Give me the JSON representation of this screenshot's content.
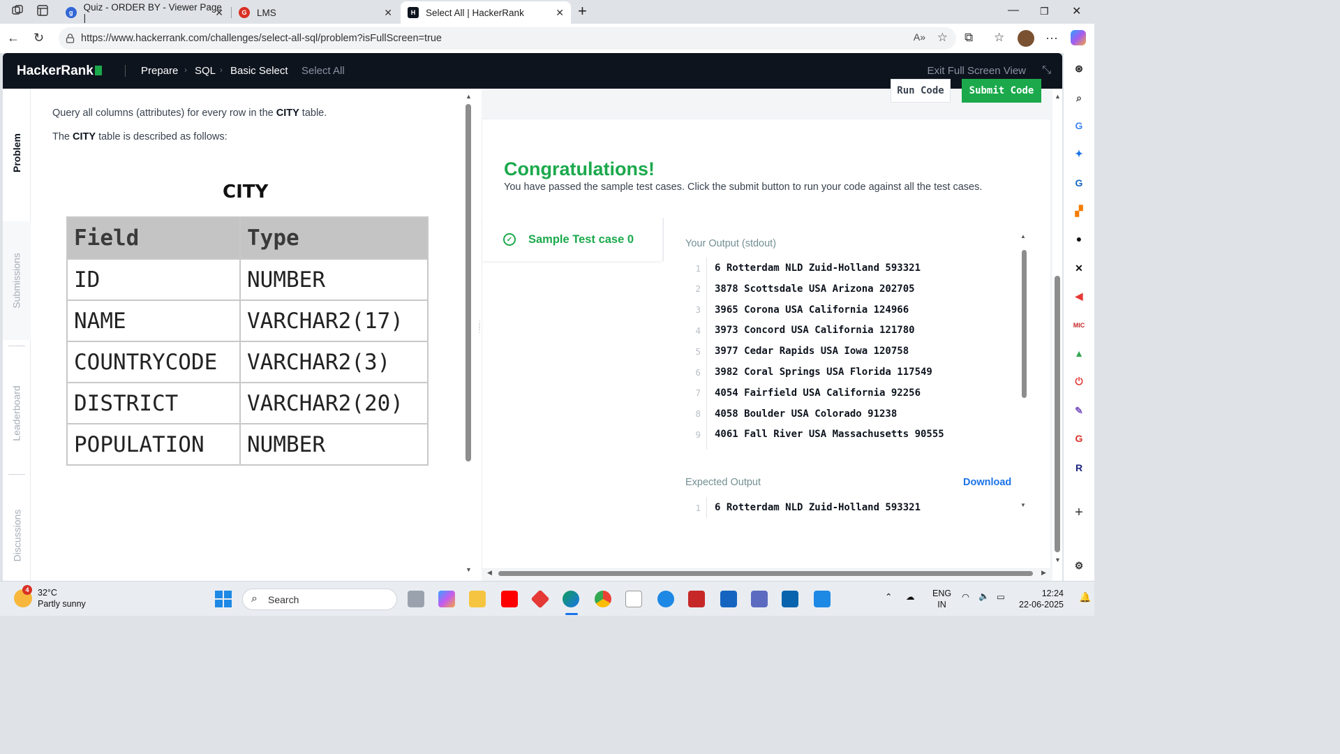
{
  "browser": {
    "tabs": [
      {
        "title": "Quiz - ORDER BY - Viewer Page |",
        "active": false
      },
      {
        "title": "LMS",
        "active": false
      },
      {
        "title": "Select All | HackerRank",
        "active": true
      }
    ],
    "url": "https://www.hackerrank.com/challenges/select-all-sql/problem?isFullScreen=true"
  },
  "header": {
    "logo": "HackerRank",
    "breadcrumbs": [
      "Prepare",
      "SQL",
      "Basic Select",
      "Select All"
    ],
    "exit_full_screen": "Exit Full Screen View"
  },
  "side_tabs": {
    "problem": "Problem",
    "submissions": "Submissions",
    "leaderboard": "Leaderboard",
    "discussions": "Discussions"
  },
  "problem": {
    "line1_pre": "Query all columns (attributes) for every row in the ",
    "line1_bold": "CITY",
    "line1_post": " table.",
    "line2_pre": "The ",
    "line2_bold": "CITY",
    "line2_post": " table is described as follows:",
    "table_title": "CITY",
    "table_headers": [
      "Field",
      "Type"
    ],
    "table_rows": [
      [
        "ID",
        "NUMBER"
      ],
      [
        "NAME",
        "VARCHAR2(17)"
      ],
      [
        "COUNTRYCODE",
        "VARCHAR2(3)"
      ],
      [
        "DISTRICT",
        "VARCHAR2(20)"
      ],
      [
        "POPULATION",
        "NUMBER"
      ]
    ]
  },
  "actions": {
    "run": "Run Code",
    "submit": "Submit Code"
  },
  "result": {
    "title": "Congratulations!",
    "message": "You have passed the sample test cases. Click the submit button to run your code against all the test cases.",
    "testcase": "Sample Test case 0",
    "output_label": "Your Output (stdout)",
    "output_lines": [
      "6 Rotterdam NLD Zuid-Holland 593321",
      "3878 Scottsdale USA Arizona 202705",
      "3965 Corona USA California 124966",
      "3973 Concord USA California 121780",
      "3977 Cedar Rapids USA Iowa 120758",
      "3982 Coral Springs USA Florida 117549",
      "4054 Fairfield USA California 92256",
      "4058 Boulder USA Colorado 91238",
      "4061 Fall River USA Massachusetts 90555"
    ],
    "expected_label": "Expected Output",
    "download": "Download",
    "expected_lines": [
      "6 Rotterdam NLD Zuid-Holland 593321"
    ]
  },
  "taskbar": {
    "temperature": "32°C",
    "weather": "Partly sunny",
    "weather_badge": "4",
    "search": "Search",
    "lang1": "ENG",
    "lang2": "IN",
    "time": "12:24",
    "date": "22-06-2025"
  }
}
